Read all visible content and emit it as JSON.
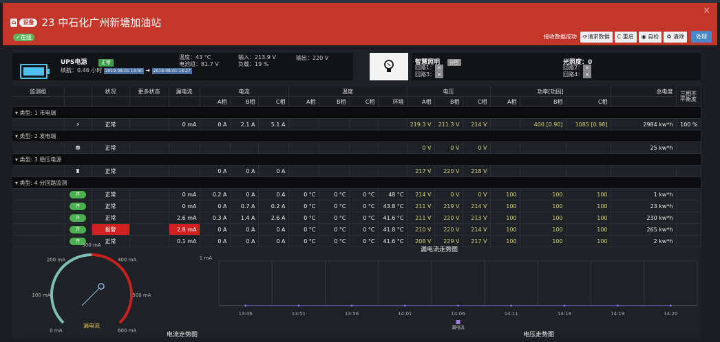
{
  "header": {
    "title": "23 中石化广州新塘加油站",
    "badge1": "⌂",
    "badge2": "设备",
    "status": "✓在线",
    "close": "×",
    "recv_text": "接收数据成功",
    "buttons": [
      "⟳请求数据",
      "C 重启",
      "◉ 自检",
      "♻ 清除"
    ],
    "process": "处理"
  },
  "ups": {
    "name": "UPS电源",
    "status": "正常",
    "duration": "续航：0.46 小时",
    "date_from": "2019-08-01 14:00",
    "arrow": "➜",
    "date_to": "2019-08-01 14:27",
    "temp": "温度：43 °C",
    "battery": "电池组：81.7 V",
    "input": "输入：213.9 V",
    "load": "负载：19 %",
    "output": "输出：220 V"
  },
  "lighting": {
    "name": "智慧照明",
    "mode": "分控",
    "circuits": [
      "回路1：",
      "回路3："
    ],
    "circuits2": [
      "回路2：",
      "回路4："
    ],
    "lux": "光照度：0"
  },
  "table": {
    "h1": [
      "监测组",
      "状况",
      "更多状态",
      "漏电流",
      "电流",
      "温度",
      "电压",
      "功率[功因]",
      "总电度",
      "三相不平衡度"
    ],
    "h2": [
      "A相",
      "B相",
      "C相",
      "A相",
      "B相",
      "C相",
      "环境",
      "A相",
      "B相",
      "C相",
      "A相",
      "B相",
      "C相"
    ],
    "groups": [
      {
        "label": "▾ 类型: 1 市电端",
        "rows": [
          {
            "icon": "⚡",
            "status": "正常",
            "leak": "0 mA",
            "i": [
              "0 A",
              "2.1 A",
              "5.1 A"
            ],
            "t": [
              "",
              "",
              "",
              ""
            ],
            "v": [
              "219.3 V",
              "211.3 V",
              "214 V"
            ],
            "p": [
              "",
              "400 [0.90]",
              "1085 [0.98]"
            ],
            "energy": "2984 kw*h",
            "unb": "100 %"
          }
        ]
      },
      {
        "label": "▾ 类型: 2 发电端",
        "rows": [
          {
            "icon": "⛃",
            "status": "正常",
            "leak": "",
            "i": [
              "",
              "",
              ""
            ],
            "t": [
              "",
              "",
              "",
              ""
            ],
            "v": [
              "0 V",
              "0 V",
              "0 V"
            ],
            "p": [
              "",
              "",
              ""
            ],
            "energy": "25 kw*h",
            "unb": ""
          }
        ]
      },
      {
        "label": "▾ 类型: 3 稳压电源",
        "rows": [
          {
            "icon": "♜",
            "status": "正常",
            "leak": "",
            "i": [
              "0 A",
              "0 A",
              "0 A"
            ],
            "t": [
              "",
              "",
              "",
              ""
            ],
            "v": [
              "217 V",
              "220 V",
              "218 V"
            ],
            "p": [
              "",
              "",
              ""
            ],
            "energy": "",
            "unb": ""
          }
        ]
      },
      {
        "label": "▾ 类型: 4 分回路监测",
        "rows": [
          {
            "icon": "开",
            "status": "正常",
            "leak": "0 mA",
            "i": [
              "0.2 A",
              "0 A",
              "0 A"
            ],
            "t": [
              "0 °C",
              "0 °C",
              "0 °C",
              "48 °C"
            ],
            "v": [
              "214 V",
              "0 V",
              "0 V"
            ],
            "p": [
              "100",
              "100",
              "100"
            ],
            "energy": "1 kw*h",
            "unb": ""
          },
          {
            "icon": "开",
            "status": "正常",
            "leak": "0 mA",
            "i": [
              "0 A",
              "0.7 A",
              "0.2 A"
            ],
            "t": [
              "0 °C",
              "0 °C",
              "0 °C",
              "43.8 °C"
            ],
            "v": [
              "211 V",
              "219 V",
              "214 V"
            ],
            "p": [
              "100",
              "100",
              "100"
            ],
            "energy": "23 kw*h",
            "unb": ""
          },
          {
            "icon": "开",
            "status": "正常",
            "leak": "2.6 mA",
            "i": [
              "0.3 A",
              "1.4 A",
              "2.6 A"
            ],
            "t": [
              "0 °C",
              "0 °C",
              "0 °C",
              "41.6 °C"
            ],
            "v": [
              "211 V",
              "220 V",
              "213 V"
            ],
            "p": [
              "100",
              "100",
              "100"
            ],
            "energy": "230 kw*h",
            "unb": ""
          },
          {
            "icon": "开",
            "status": "报警",
            "leak": "2.8 mA",
            "i": [
              "0 A",
              "0 A",
              "0 A"
            ],
            "t": [
              "0 °C",
              "0 °C",
              "0 °C",
              "41.8 °C"
            ],
            "v": [
              "210 V",
              "220 V",
              "214 V"
            ],
            "p": [
              "100",
              "100",
              "100"
            ],
            "energy": "265 kw*h",
            "unb": "",
            "alarm": true
          },
          {
            "icon": "开",
            "status": "正常",
            "leak": "0.1 mA",
            "i": [
              "0 A",
              "0 A",
              "0 A"
            ],
            "t": [
              "0 °C",
              "0 °C",
              "0 °C",
              "41.6 °C"
            ],
            "v": [
              "208 V",
              "229 V",
              "217 V"
            ],
            "p": [
              "100",
              "100",
              "100"
            ],
            "energy": "2 kw*h",
            "unb": ""
          }
        ]
      }
    ]
  },
  "gauge": {
    "value": 2.8,
    "min": 0,
    "max": 600,
    "labels": [
      "0 mA",
      "100 mA",
      "200 mA",
      "300 mA",
      "400 mA",
      "500 mA",
      "600 mA"
    ],
    "caption": "漏电流"
  },
  "chart_data": {
    "type": "line",
    "title": "漏电流走势图",
    "x": [
      "13:46",
      "13:51",
      "13:56",
      "14:01",
      "14:06",
      "14:11",
      "14:18",
      "14:19",
      "14:20"
    ],
    "series": [
      {
        "name": "漏电流",
        "values": [
          0,
          0,
          0,
          0,
          0,
          0,
          0,
          0,
          0
        ]
      }
    ],
    "ylabel": "1 mA",
    "ylim": [
      0,
      1
    ],
    "legend": "bottom-center",
    "grid": true
  },
  "bottom": {
    "current_chart": "电流走势图",
    "voltage_chart": "电压走势图"
  },
  "colors": {
    "header": "#c5362a",
    "alarm": "#d02121",
    "yellow": "#d9d27b",
    "blue": "#4a87c9",
    "green": "#4caf50"
  }
}
